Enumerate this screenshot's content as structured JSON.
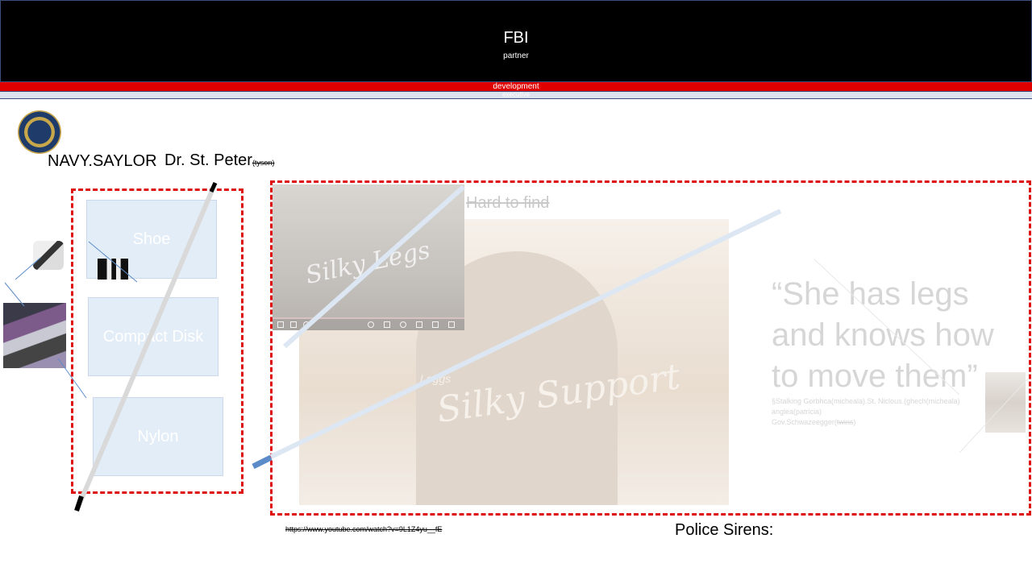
{
  "header": {
    "title": "FBI",
    "subtitle": "partner",
    "band_label": "development",
    "band2_label": "executive"
  },
  "names": {
    "left": "NAVY.SAYLOR",
    "right": "Dr. St. Peter",
    "right_note": "(tyson)"
  },
  "categories": [
    {
      "label": "Shoe"
    },
    {
      "label": "Compact Disk"
    },
    {
      "label": "Nylon"
    }
  ],
  "video": {
    "mini_title": "Silky Legs",
    "brand": "Leggs",
    "label": "Silky Support"
  },
  "hard_to_find": "Hard to find",
  "quote": {
    "text": "“She has legs and knows how to move them”",
    "meta_line1": "§Stalking Gorbhca(micheala).St. Niclous.(ghech(micheala)",
    "meta_line2": "anglea(patricia)",
    "meta_line3a": "Gov.Schwazeegger(",
    "meta_line3b": "twins",
    "meta_line3c": ")"
  },
  "footer": {
    "url": "https://www.youtube.com/watch?v=9L1Z4yu__fE",
    "sirens": "Police Sirens:"
  },
  "colors": {
    "accent_red": "#dd1111",
    "header_bg": "#000000",
    "category_bg": "#e3edf7"
  }
}
